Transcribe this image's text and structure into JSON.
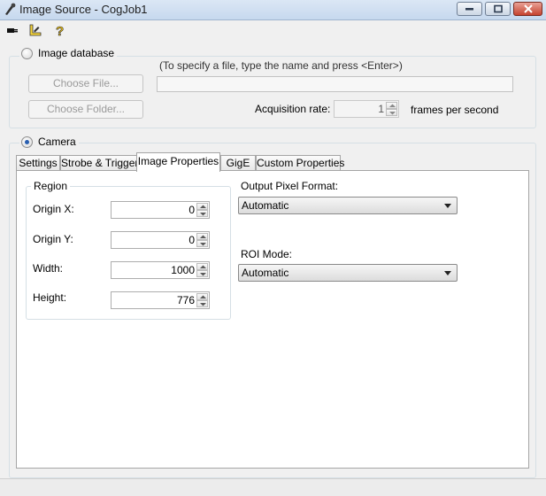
{
  "window": {
    "title": "Image Source - CogJob1"
  },
  "toolbar": {
    "icons": [
      "plug-icon",
      "ruler-pencil-icon",
      "help-question-icon"
    ]
  },
  "image_database": {
    "label": "Image database",
    "selected": false,
    "choose_file_label": "Choose File...",
    "choose_folder_label": "Choose Folder...",
    "hint": "(To specify a file, type the name and press <Enter>)",
    "file_value": "",
    "acquisition_rate_label": "Acquisition rate:",
    "acquisition_rate_value": "1",
    "frames_unit": "frames per second"
  },
  "camera": {
    "label": "Camera",
    "selected": true
  },
  "tabs": [
    {
      "label": "Settings",
      "active": false
    },
    {
      "label": "Strobe & Trigger",
      "active": false
    },
    {
      "label": "Image Properties",
      "active": true
    },
    {
      "label": "GigE",
      "active": false
    },
    {
      "label": "Custom Properties",
      "active": false
    }
  ],
  "region": {
    "title": "Region",
    "origin_x_label": "Origin X:",
    "origin_x_value": "0",
    "origin_y_label": "Origin Y:",
    "origin_y_value": "0",
    "width_label": "Width:",
    "width_value": "1000",
    "height_label": "Height:",
    "height_value": "776"
  },
  "output_pixel_format": {
    "label": "Output Pixel Format:",
    "value": "Automatic"
  },
  "roi_mode": {
    "label": "ROI Mode:",
    "value": "Automatic"
  },
  "colors": {
    "accent": "#2a5fb0",
    "close_button": "#c5432f"
  }
}
